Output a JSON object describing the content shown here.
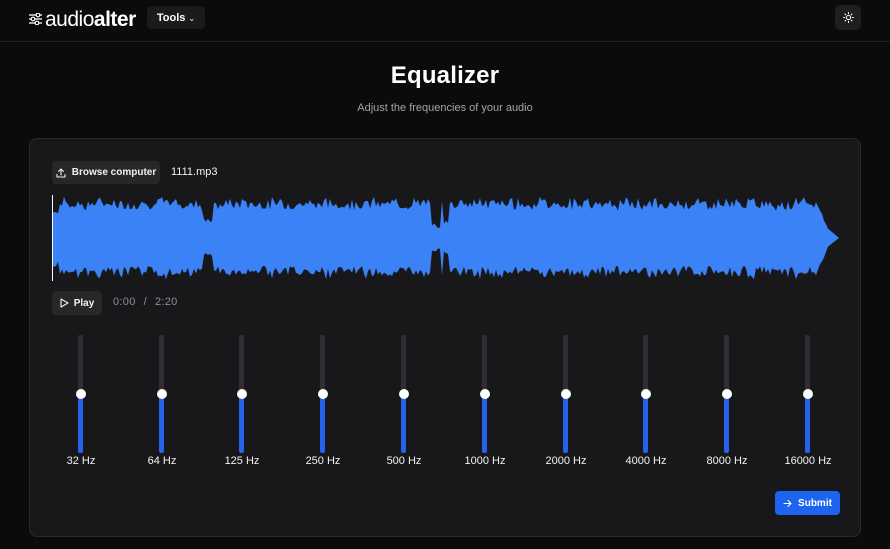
{
  "header": {
    "logo_light": "audio",
    "logo_bold": "alter",
    "tools_label": "Tools",
    "tools_icon": "chevron-down-icon",
    "theme_icon": "sun-icon"
  },
  "page": {
    "title": "Equalizer",
    "subtitle": "Adjust the frequencies of your audio"
  },
  "player": {
    "browse_label": "Browse computer",
    "browse_icon": "upload-icon",
    "file_name": "1111.mp3",
    "play_label": "Play",
    "play_icon": "play-icon",
    "current_time": "0:00",
    "time_separator": "/",
    "duration": "2:20",
    "waveform_color": "#3b82f6"
  },
  "equalizer": {
    "accent_color": "#2563eb",
    "bands": [
      {
        "label": "32 Hz",
        "level": 0.5
      },
      {
        "label": "64 Hz",
        "level": 0.5
      },
      {
        "label": "125 Hz",
        "level": 0.5
      },
      {
        "label": "250 Hz",
        "level": 0.5
      },
      {
        "label": "500 Hz",
        "level": 0.5
      },
      {
        "label": "1000 Hz",
        "level": 0.5
      },
      {
        "label": "2000 Hz",
        "level": 0.5
      },
      {
        "label": "4000 Hz",
        "level": 0.5
      },
      {
        "label": "8000 Hz",
        "level": 0.5
      },
      {
        "label": "16000 Hz",
        "level": 0.5
      }
    ]
  },
  "actions": {
    "submit_label": "Submit",
    "submit_icon": "arrow-right-icon"
  }
}
